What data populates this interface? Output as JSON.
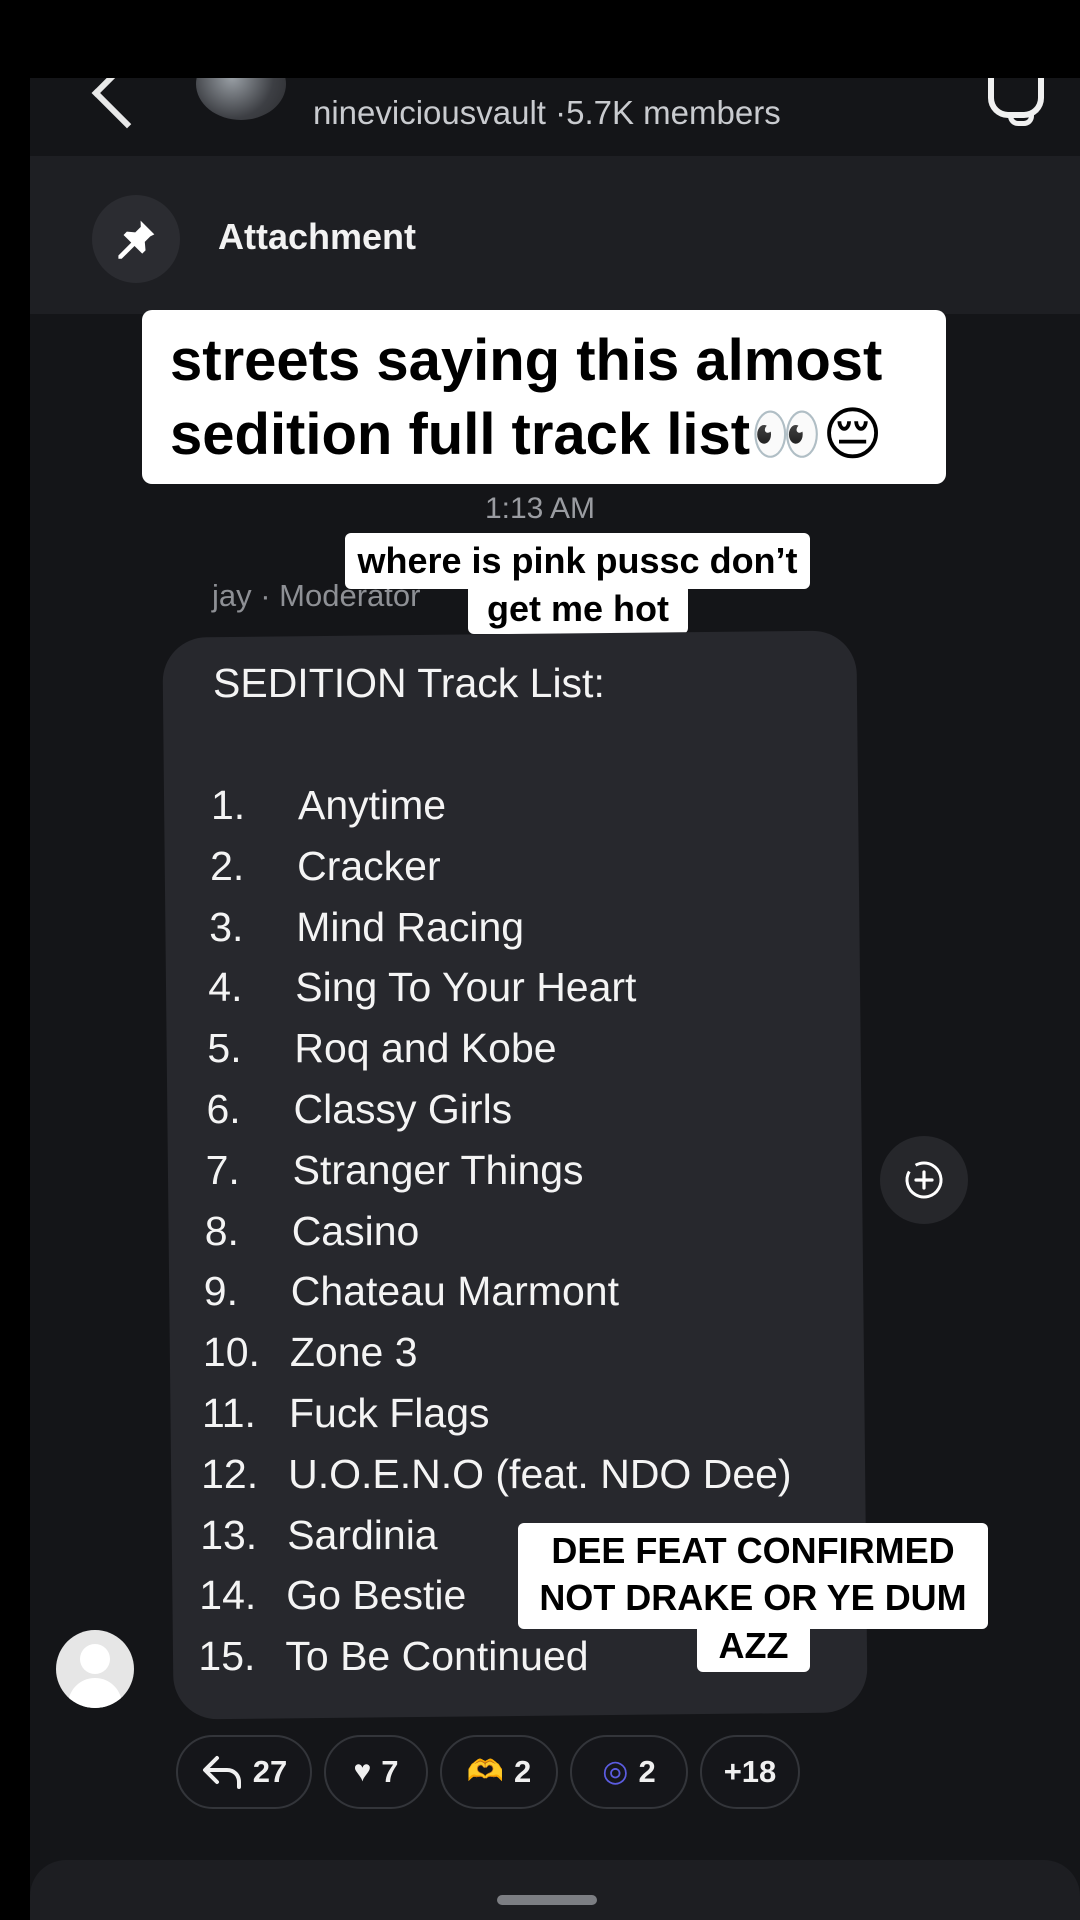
{
  "header": {
    "group_name": "nineviciousvault",
    "members": "·5.7K members"
  },
  "attachment_bar": {
    "label": "Attachment"
  },
  "caption": {
    "line1": "streets saying this almost",
    "line2": "sedition full track list👀😔"
  },
  "message": {
    "timestamp": "1:13 AM",
    "author": "jay · Moderator",
    "title": "SEDITION Track List:",
    "tracks": [
      {
        "num": "1.",
        "name": "Anytime"
      },
      {
        "num": "2.",
        "name": "Cracker"
      },
      {
        "num": "3.",
        "name": "Mind Racing"
      },
      {
        "num": "4.",
        "name": "Sing To Your Heart"
      },
      {
        "num": "5.",
        "name": "Roq and Kobe"
      },
      {
        "num": "6.",
        "name": "Classy Girls"
      },
      {
        "num": "7.",
        "name": "Stranger Things"
      },
      {
        "num": "8.",
        "name": "Casino"
      },
      {
        "num": "9.",
        "name": "Chateau Marmont"
      },
      {
        "num": "10.",
        "name": "Zone 3"
      },
      {
        "num": "11.",
        "name": "Fuck Flags"
      },
      {
        "num": "12.",
        "name": "U.O.E.N.O (feat. NDO Dee)"
      },
      {
        "num": "13.",
        "name": "Sardinia"
      },
      {
        "num": "14.",
        "name": "Go Bestie"
      },
      {
        "num": "15.",
        "name": "To Be Continued"
      }
    ]
  },
  "overlay_text": {
    "sticker1_line1": "where is pink pussc don’t",
    "sticker1_line2": "get me hot",
    "sticker2_line1": "DEE FEAT CONFIRMED",
    "sticker2_line2": "NOT DRAKE OR YE DUM",
    "sticker2_line3": "AZZ"
  },
  "reactions": {
    "reply_count": "27",
    "heart_count": "7",
    "hands_count": "2",
    "fingerprint_count": "2",
    "more": "+18"
  },
  "icons": {
    "back": "back-arrow-icon",
    "bell": "bell-icon",
    "pin": "pin-icon",
    "add_reaction": "add-reaction-icon",
    "reply": "reply-icon",
    "heart": "heart-icon",
    "heart_hands": "heart-hands-icon",
    "fingerprint": "fingerprint-icon"
  },
  "colors": {
    "background": "#141518",
    "bubble": "#27282d",
    "sticker": "#ffffff"
  }
}
